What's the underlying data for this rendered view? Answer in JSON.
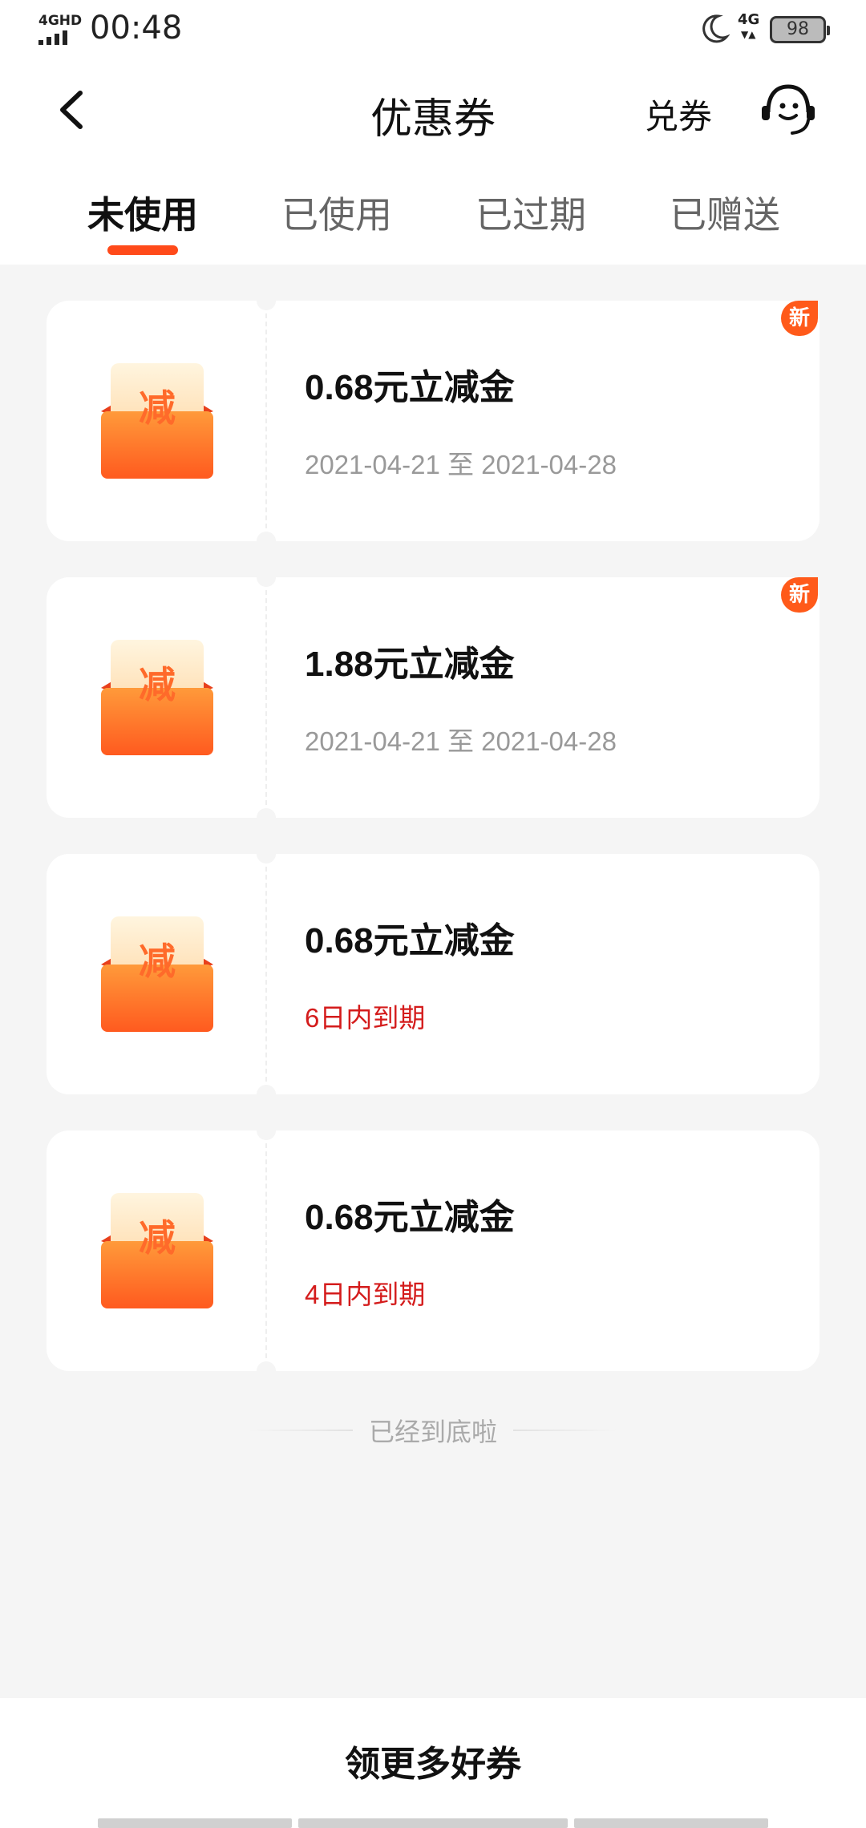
{
  "status_bar": {
    "network_label": "4GHD",
    "time": "00:48",
    "mobile_label": "4G",
    "battery": "98"
  },
  "header": {
    "title": "优惠券",
    "redeem_label": "兑券"
  },
  "tabs": [
    {
      "label": "未使用",
      "active": true
    },
    {
      "label": "已使用",
      "active": false
    },
    {
      "label": "已过期",
      "active": false
    },
    {
      "label": "已赠送",
      "active": false
    }
  ],
  "coupons": [
    {
      "icon": "减",
      "title": "0.68元立减金",
      "subtitle": "2021-04-21 至 2021-04-28",
      "badge": "新"
    },
    {
      "icon": "减",
      "title": "1.88元立减金",
      "subtitle": "2021-04-21 至 2021-04-28",
      "badge": "新"
    },
    {
      "icon": "减",
      "title": "0.68元立减金",
      "subtitle": "6日内到期",
      "badge": ""
    },
    {
      "icon": "减",
      "title": "0.68元立减金",
      "subtitle": "4日内到期",
      "badge": ""
    }
  ],
  "end_text": "已经到底啦",
  "bottom_button": "领更多好券",
  "colors": {
    "accent": "#ff4a1a",
    "expiring_text": "#d41c1c",
    "background": "#f5f5f5"
  }
}
